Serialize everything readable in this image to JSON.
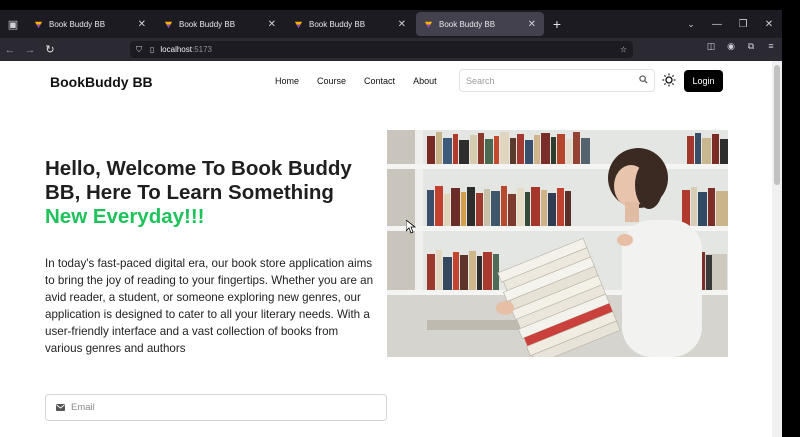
{
  "browser": {
    "tabs": [
      {
        "title": "Book Buddy BB",
        "active": false
      },
      {
        "title": "Book Buddy BB",
        "active": false
      },
      {
        "title": "Book Buddy BB",
        "active": false
      },
      {
        "title": "Book Buddy BB",
        "active": true
      }
    ],
    "url": {
      "host": "localhost",
      "port": ":5173"
    }
  },
  "site": {
    "brand": "BookBuddy BB",
    "menu": [
      "Home",
      "Course",
      "Contact",
      "About"
    ],
    "search_placeholder": "Search",
    "login_label": "Login"
  },
  "hero": {
    "title_main": "Hello, Welcome To Book Buddy BB, Here To Learn Something",
    "title_accent": "New Everyday!!!",
    "description": "In today's fast-paced digital era, our book store application aims to bring the joy of reading to your fingertips. Whether you are an avid reader, a student, or someone exploring new genres, our application is designed to cater to all your literary needs. With a user-friendly interface and a vast collection of books from various genres and authors",
    "email_placeholder": "Email"
  },
  "colors": {
    "accent": "#1ec25a",
    "login_bg": "#000000",
    "tabbar_bg": "#1c1b22",
    "active_tab_bg": "#42414d",
    "navbar_bg": "#2b2a33"
  }
}
